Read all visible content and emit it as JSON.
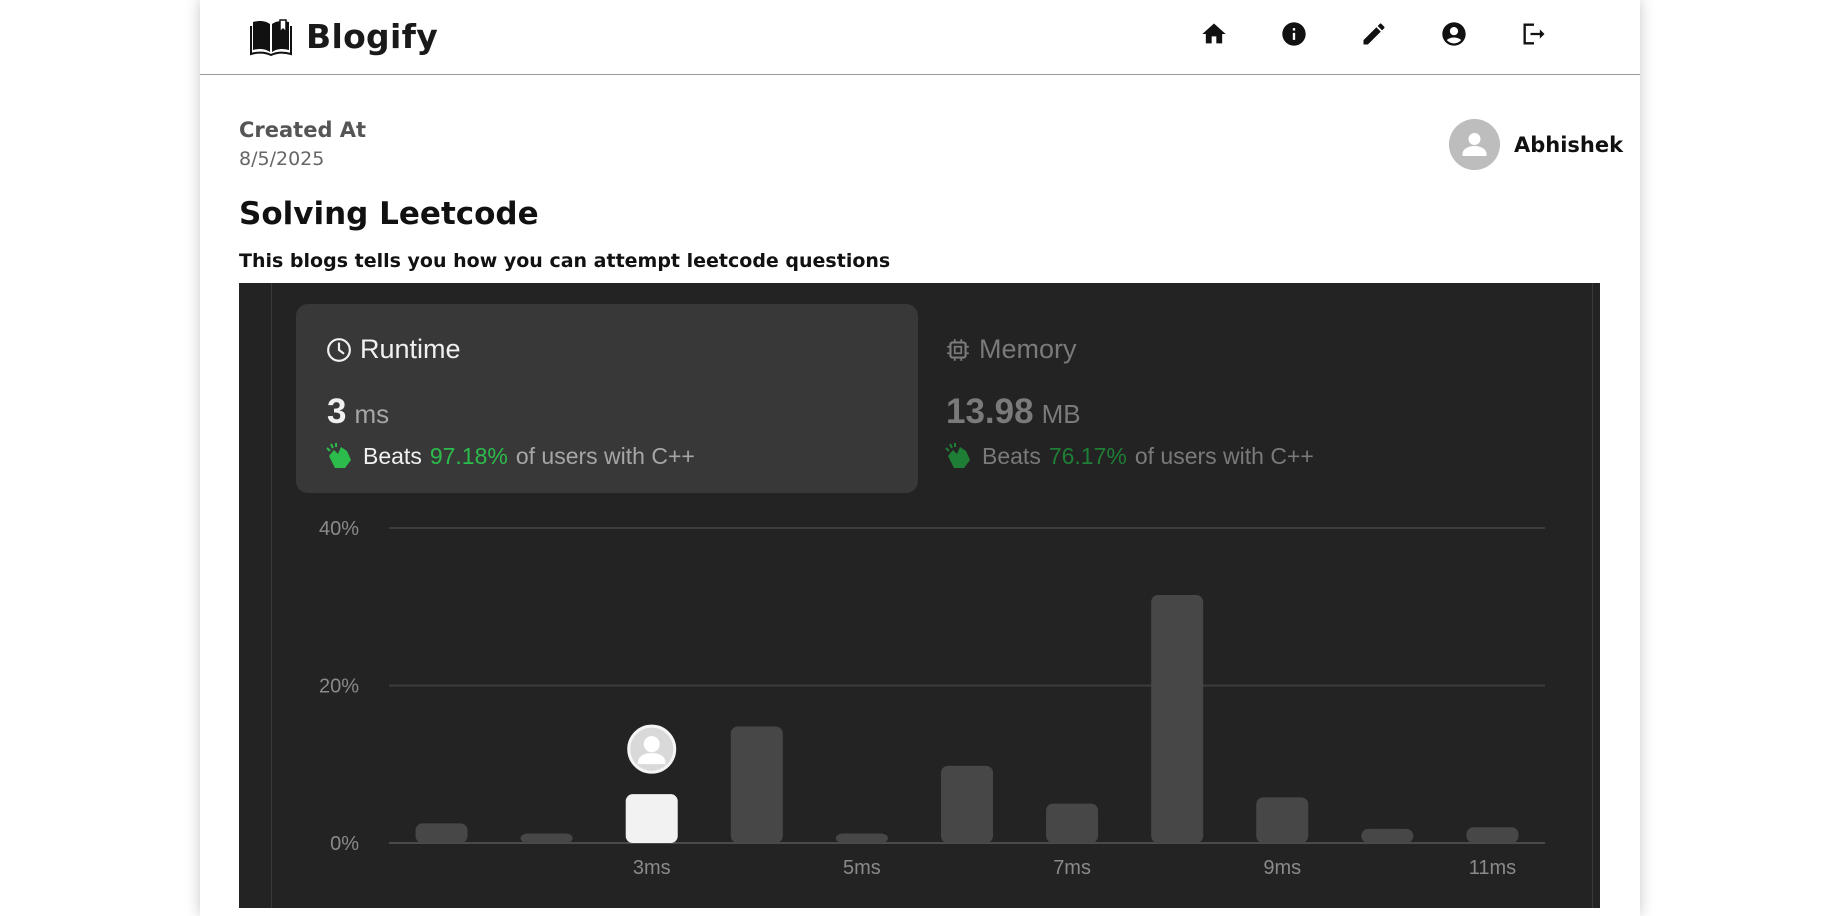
{
  "brand": {
    "name": "Blogify"
  },
  "nav": {
    "icons": [
      "home-icon",
      "info-icon",
      "edit-icon",
      "account-icon",
      "logout-icon"
    ]
  },
  "post": {
    "created_label": "Created At",
    "created_date": "8/5/2025",
    "author": "Abhishek",
    "title": "Solving Leetcode",
    "description": "This blogs tells you how you can attempt leetcode questions"
  },
  "embedded_image": {
    "runtime": {
      "label": "Runtime",
      "value": "3",
      "unit": "ms",
      "beats_word": "Beats",
      "beats_pct": "97.18%",
      "beats_rest": "of users with C++"
    },
    "memory": {
      "label": "Memory",
      "value": "13.98",
      "unit": "MB",
      "beats_word": "Beats",
      "beats_pct": "76.17%",
      "beats_rest": "of users with C++"
    }
  },
  "colors": {
    "accent_green": "#2cbc4b",
    "chart_bg": "#232323",
    "bar": "#474747",
    "bar_highlight": "#f2f2f2"
  },
  "chart_data": {
    "type": "bar",
    "categories": [
      "1ms",
      "2ms",
      "3ms",
      "4ms",
      "5ms",
      "6ms",
      "7ms",
      "8ms",
      "9ms",
      "10ms",
      "11ms"
    ],
    "values": [
      2.5,
      1.2,
      6.2,
      14.8,
      1.2,
      9.8,
      5.0,
      31.5,
      5.8,
      1.8,
      2.0
    ],
    "highlight_category": "3ms",
    "x_tick_labels": [
      "3ms",
      "5ms",
      "7ms",
      "9ms",
      "11ms"
    ],
    "y_ticks": [
      "0%",
      "20%",
      "40%"
    ],
    "ylim": [
      0,
      40
    ],
    "grid": true
  }
}
